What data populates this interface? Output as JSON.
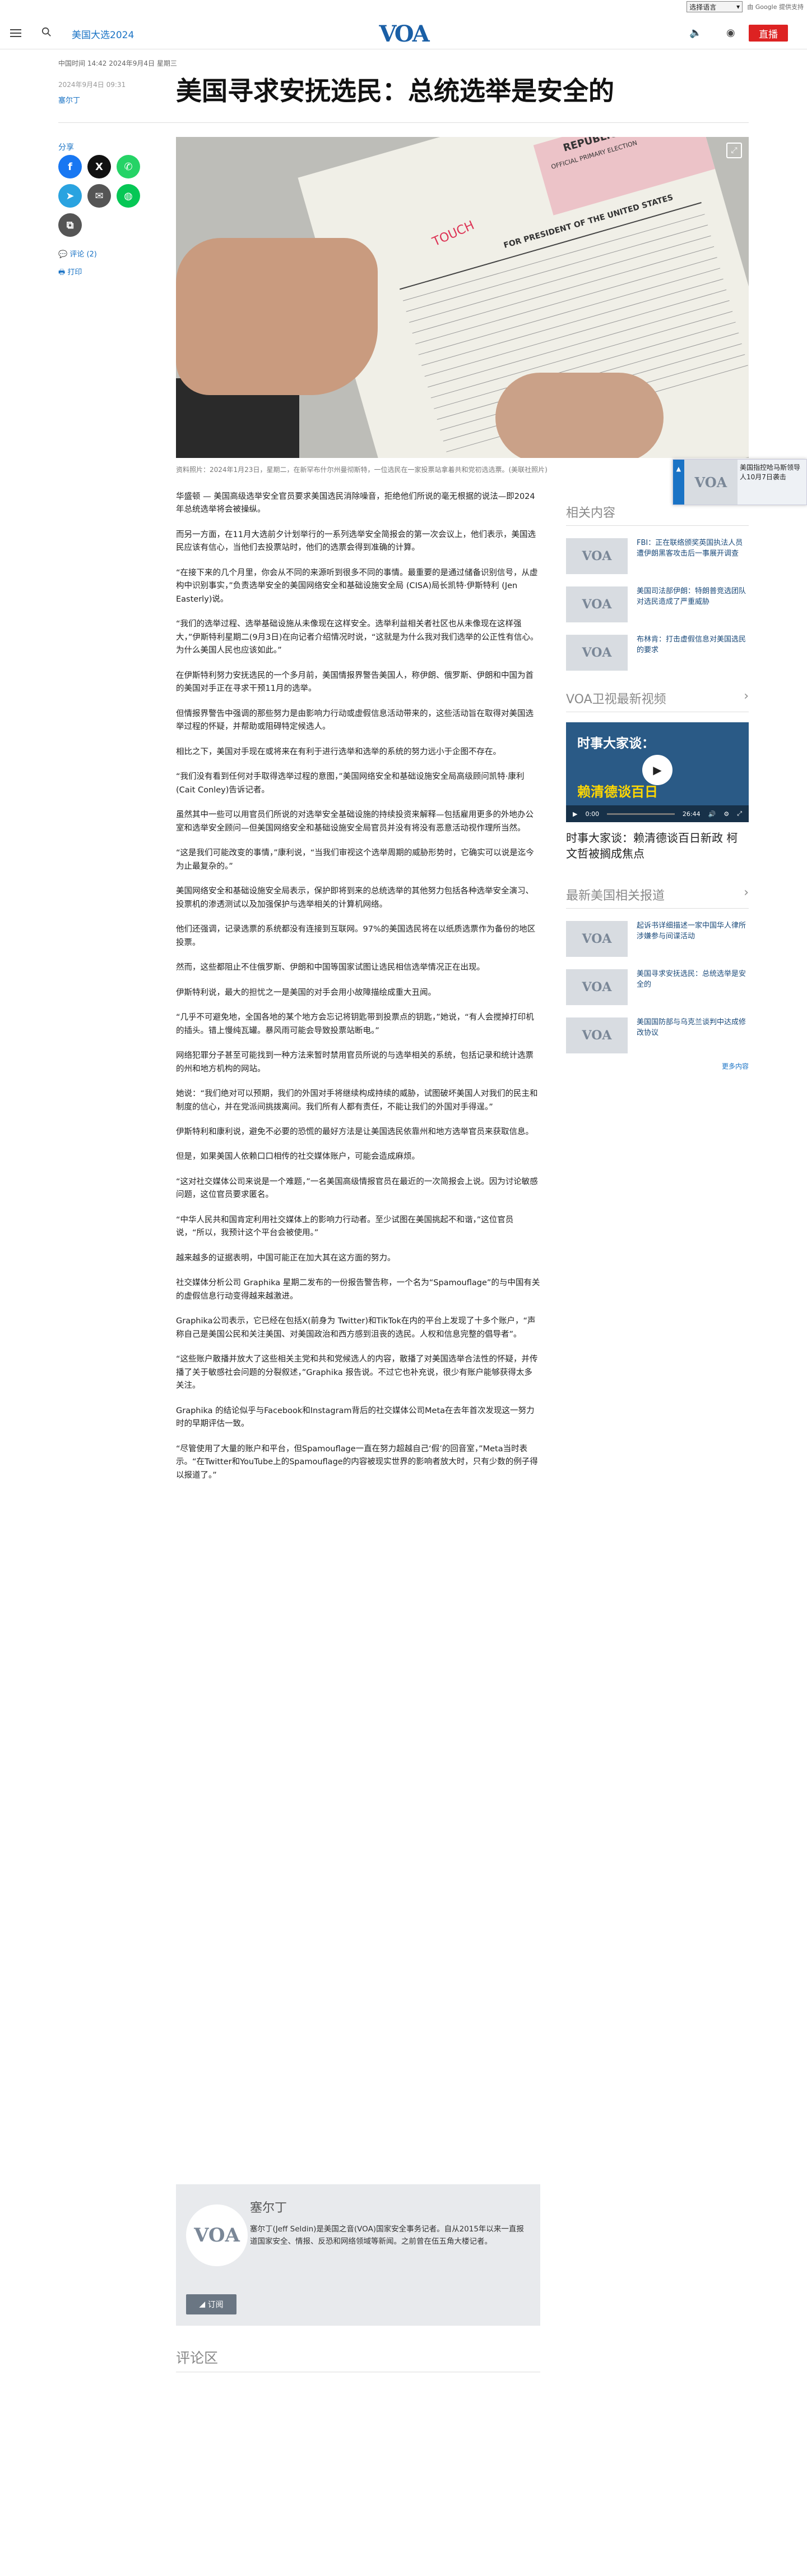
{
  "topbar": {
    "lang_select": "选择语言",
    "powered_by": "由 Google 提供支持"
  },
  "header": {
    "section_link": "美国大选2024",
    "live_label": "直播",
    "logo": "VOA"
  },
  "dateline": "中国时间 14:42 2024年9月4日 星期三",
  "meta": {
    "date": "2024年9月4日 09:31",
    "author": "塞尔丁"
  },
  "title": "美国寻求安抚选民：总统选举是安全的",
  "share": {
    "label": "分享",
    "comments": "评论 (2)",
    "print": "打印"
  },
  "hero": {
    "ballot_heading": "OFFICIAL PRIMARY ELECTION",
    "ballot_party": "REPUBLICAN",
    "ballot_office": "FOR PRESIDENT OF THE UNITED STATES",
    "ballot_stamp": "TOUCH"
  },
  "caption": "资料照片：2024年1月23日，星期二，在新罕布什尔州曼彻斯特，一位选民在一家投票站拿着共和党初选选票。(美联社照片)",
  "paragraphs": [
    "华盛顿 — 美国高级选举安全官员要求美国选民消除噪音，拒绝他们所说的毫无根据的说法—即2024年总统选举将会被操纵。",
    "而另一方面，在11月大选前夕计划举行的一系列选举安全简报会的第一次会议上，他们表示，美国选民应该有信心，当他们去投票站时，他们的选票会得到准确的计算。",
    "“在接下来的几个月里，你会从不同的来源听到很多不同的事情。最重要的是通过储备识别信号，从虚构中识别事实，”负责选举安全的美国网络安全和基础设施安全局 (CISA)局长凯特·伊斯特利 (Jen Easterly)说。",
    "“我们的选举过程、选举基础设施从未像现在这样安全。选举利益相关者社区也从未像现在这样强大，”伊斯特利星期二(9月3日)在向记者介绍情况时说，“这就是为什么我对我们选举的公正性有信心。为什么美国人民也应该如此。”",
    "在伊斯特利努力安抚选民的一个多月前，美国情报界警告美国人，称伊朗、俄罗斯、伊朗和中国为首的美国对手正在寻求干预11月的选举。",
    "但情报界警告中强调的那些努力是由影响力行动或虚假信息活动带来的，这些活动旨在取得对美国选举过程的怀疑，并帮助或阻碍特定候选人。",
    "相比之下，美国对手现在或将来在有利于进行选举和选举的系统的努力远小于企图不存在。",
    "“我们没有看到任何对手取得选举过程的意图，”美国网络安全和基础设施安全局高级顾问凯特·康利(Cait Conley)告诉记者。",
    "虽然其中一些可以用官员们所说的对选举安全基础设施的持续投资来解释—包括雇用更多的外地办公室和选举安全顾问—但美国网络安全和基础设施安全局官员并没有将没有恶意活动视作理所当然。",
    "“这是我们可能改变的事情，”康利说，“当我们审视这个选举周期的威胁形势时，它确实可以说是迄今为止最复杂的。”",
    "美国网络安全和基础设施安全局表示，保护即将到来的总统选举的其他努力包括各种选举安全演习、投票机的渗透测试以及加强保护与选举相关的计算机网络。",
    "他们还强调，记录选票的系统都没有连接到互联网。97%的美国选民将在以纸质选票作为备份的地区投票。",
    "然而，这些都阻止不住俄罗斯、伊朗和中国等国家试图让选民相信选举情况正在出现。",
    "伊斯特利说，最大的担忧之一是美国的对手会用小故障描绘成重大丑闻。",
    "“几乎不可避免地，全国各地的某个地方会忘记将钥匙带到投票点的钥匙，”她说，“有人会搅掉打印机的插头。错上慢纯瓦罐。暴风雨可能会导致投票站断电。”",
    "网络犯罪分子甚至可能找到一种方法来暂时禁用官员所说的与选举相关的系统，包括记录和统计选票的州和地方机构的网站。",
    "她说：“我们绝对可以预期，我们的外国对手将继续构成持续的威胁，试图破坏美国人对我们的民主和制度的信心，并在党派间挑拨离间。我们所有人都有责任，不能让我们的外国对手得逞。”",
    "伊斯特利和康利说，避免不必要的恐慌的最好方法是让美国选民依靠州和地方选举官员来获取信息。",
    "但是，如果美国人依赖口口相传的社交媒体账户，可能会造成麻烦。",
    "“这对社交媒体公司来说是一个难题，”一名美国高级情报官员在最近的一次简报会上说。因为讨论敏感问题，这位官员要求匿名。",
    "“中华人民共和国肯定利用社交媒体上的影响力行动者。至少试图在美国挑起不和谐，”这位官员说，“所以，我预计这个平台会被使用。”",
    "越来越多的证据表明，中国可能正在加大其在这方面的努力。",
    "社交媒体分析公司 Graphika 星期二发布的一份报告警告称，一个名为“Spamouflage”的与中国有关的虚假信息行动变得越来越激进。",
    "Graphika公司表示，它已经在包括X(前身为 Twitter)和TikTok在内的平台上发现了十多个账户，“声称自己是美国公民和关注美国、对美国政治和西方感到沮丧的选民。人权和信息完整的倡导者”。",
    "“这些账户散播并放大了这些相关主党和共和党候选人的内容，散播了对美国选举合法性的怀疑，并传播了关于敏感社会问题的分裂叙述，”Graphika 报告说。不过它也补充说，很少有账户能够获得太多关注。",
    "Graphika 的结论似乎与Facebook和Instagram背后的社交媒体公司Meta在去年首次发现这一努力时的早期评估一致。",
    "“尽管使用了大量的账户和平台，但Spamouflage一直在努力超越自己‘假’的回音室，”Meta当时表示。“在Twitter和YouTube上的Spamouflage的内容被现实世界的影响者放大时，只有少数的例子得以报道了。”"
  ],
  "related": {
    "title": "相关内容",
    "items": [
      "FBI：正在联络颁奖英国执法人员遭伊朗黑客攻击后一事展开调查",
      "美国司法部伊朗：特朗普竞选团队对选民造成了严重威胁",
      "布林肯：打击虚假信息对美国选民的要求"
    ]
  },
  "video": {
    "section_title": "VOA卫视最新视频",
    "thumb_heading": "时事大家谈：",
    "thumb_sub": "赖清德谈百日",
    "time_current": "0:00",
    "time_total": "26:44",
    "caption": "时事大家谈：赖清德谈百日新政 柯文哲被搁成焦点",
    "progress": 0
  },
  "latest": {
    "title": "最新美国相关报道",
    "items": [
      "起诉书详细描述一家中国华人律所涉嫌参与间谍活动",
      "美国寻求安抚选民：总统选举是安全的",
      "美国国防部与乌克兰谈判中达成修改协议"
    ],
    "more": "更多内容"
  },
  "float_card": {
    "text": "美国指控哈马斯领导人10月7日袭击"
  },
  "author_box": {
    "name": "塞尔丁",
    "bio": "塞尔丁(Jeff Seldin)是美国之音(VOA)国家安全事务记者。自从2015年以来一直报道国家安全、情报、反恐和网络领域等新闻。之前曾在伍五角大楼记者。",
    "subscribe": "订阅"
  },
  "comments_title": "评论区",
  "colors": {
    "brand": "#1a5fa6",
    "live": "#dd2222",
    "facebook": "#1877f2",
    "x": "#111111",
    "whatsapp": "#25d366",
    "telegram": "#2aa3e0",
    "email": "#555555",
    "line": "#06c755"
  }
}
